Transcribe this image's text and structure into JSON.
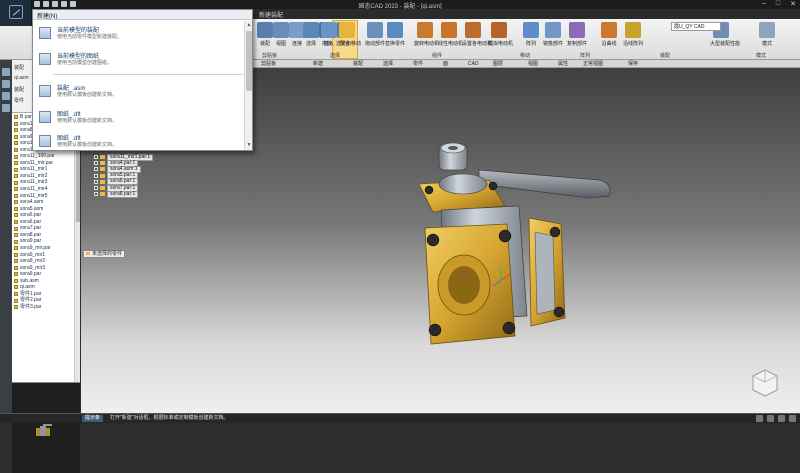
{
  "window": {
    "title": "固态CAD 2023 - 装配 - [qi.asm]",
    "controls": [
      "–",
      "□",
      "✕"
    ]
  },
  "ribbon": {
    "tabs": [
      "新建装配"
    ],
    "buttons": [
      {
        "label": "装配",
        "color": "#5a7fae"
      },
      {
        "label": "视图",
        "color": "#6b8cb8"
      },
      {
        "label": "连接",
        "color": "#7a9cc8"
      },
      {
        "label": "选择",
        "color": "#5b86b8"
      },
      {
        "label": "拖拽",
        "color": "#4c6f9b"
      },
      {
        "label": "插入",
        "color": "#6a93c6"
      },
      {
        "label": "配合",
        "color": "#577eae"
      },
      {
        "label": "选定和移动",
        "color": "#e7b43c"
      },
      {
        "label": "拖动部件",
        "color": "#6d8fbd"
      },
      {
        "label": "替换零件",
        "color": "#5a8bc2"
      },
      {
        "label": "旋转电动机",
        "color": "#c87a2e"
      },
      {
        "label": "线性电动机",
        "color": "#c8752a"
      },
      {
        "label": "设置各电动机",
        "color": "#b96e2a"
      },
      {
        "label": "模拟电动机",
        "color": "#b6632a"
      },
      {
        "label": "阵列",
        "color": "#5d8fc7"
      },
      {
        "label": "镜像部件",
        "color": "#6f97c8"
      },
      {
        "label": "复制部件",
        "color": "#8a6bb6"
      },
      {
        "label": "沿曲线",
        "color": "#c87a2e"
      },
      {
        "label": "沿线阵列",
        "color": "#c8a12e"
      },
      {
        "label": "大型装配性能",
        "color": "#6e8db7"
      },
      {
        "label": "模式",
        "color": "#8da4bf"
      }
    ],
    "groups": [
      "剪贴板",
      "选择",
      "组件",
      "移动",
      "阵列",
      "装配",
      "模式"
    ],
    "font_box": "霞U_QY CAD"
  },
  "subbar": {
    "items": [
      "剪贴板",
      "新建",
      "装配",
      "选择",
      "零件",
      "面",
      "CAD",
      "图层",
      "视图",
      "属性",
      "正常视图",
      "保存"
    ]
  },
  "dropdown": {
    "header": "新建(N)",
    "items": [
      {
        "title": "当前模型的装配",
        "desc": "使用当前零件模型新建装配。"
      },
      {
        "title": "当前模型的图纸",
        "desc": "使用当前模型创建图纸。"
      },
      {
        "title": "装配_.asm",
        "desc": "使用默认模板创建新文档。"
      },
      {
        "title": "图纸_.dft",
        "desc": "使用默认模板创建新文档。"
      },
      {
        "title": "图纸_.dft",
        "desc": "使用默认模板创建新文档。"
      }
    ]
  },
  "tree": {
    "header_rows": [
      "装配",
      "qi.asm",
      "装配",
      "零件"
    ],
    "files": [
      "B.par",
      "sora1",
      "sora8_",
      "sora9.par",
      "sora11.par",
      "sora10.par",
      "sora11_100.par",
      "sora11_mir.par",
      "sora11_mir1",
      "sora11_mir2",
      "sora11_mir3",
      "sora11_mir4",
      "sora11_mir5",
      "sora4.asm",
      "sora5.asm",
      "sora6.par",
      "sora6.par",
      "sora7.par",
      "sora8.par",
      "sora9.par",
      "sora9_mir.par",
      "sora9_mir1",
      "sora9_mir2",
      "sora9_mir3",
      "sora9.par",
      "sub.asm",
      "qi.asm",
      "零件1.par",
      "零件2.par",
      "零件3.par"
    ]
  },
  "viewport": {
    "overlay_rows": [
      "sora11_mir1.par:1",
      "sora4.par:1",
      "sora4.asm:1",
      "sora5.par:1",
      "sora6.par:1",
      "sora7.par:1",
      "sora8.par:1"
    ],
    "tag": "未选择的零件"
  },
  "status": {
    "label": "提示条",
    "text": "打开\"新建\"对话框，根据标准或定制模板创建新文档。"
  },
  "colors": {
    "brass": "#d6a531",
    "steel": "#9aa3ad",
    "handle": "#7a7f86",
    "bolt": "#2a2a2a",
    "accent": "#3e5b7b"
  }
}
